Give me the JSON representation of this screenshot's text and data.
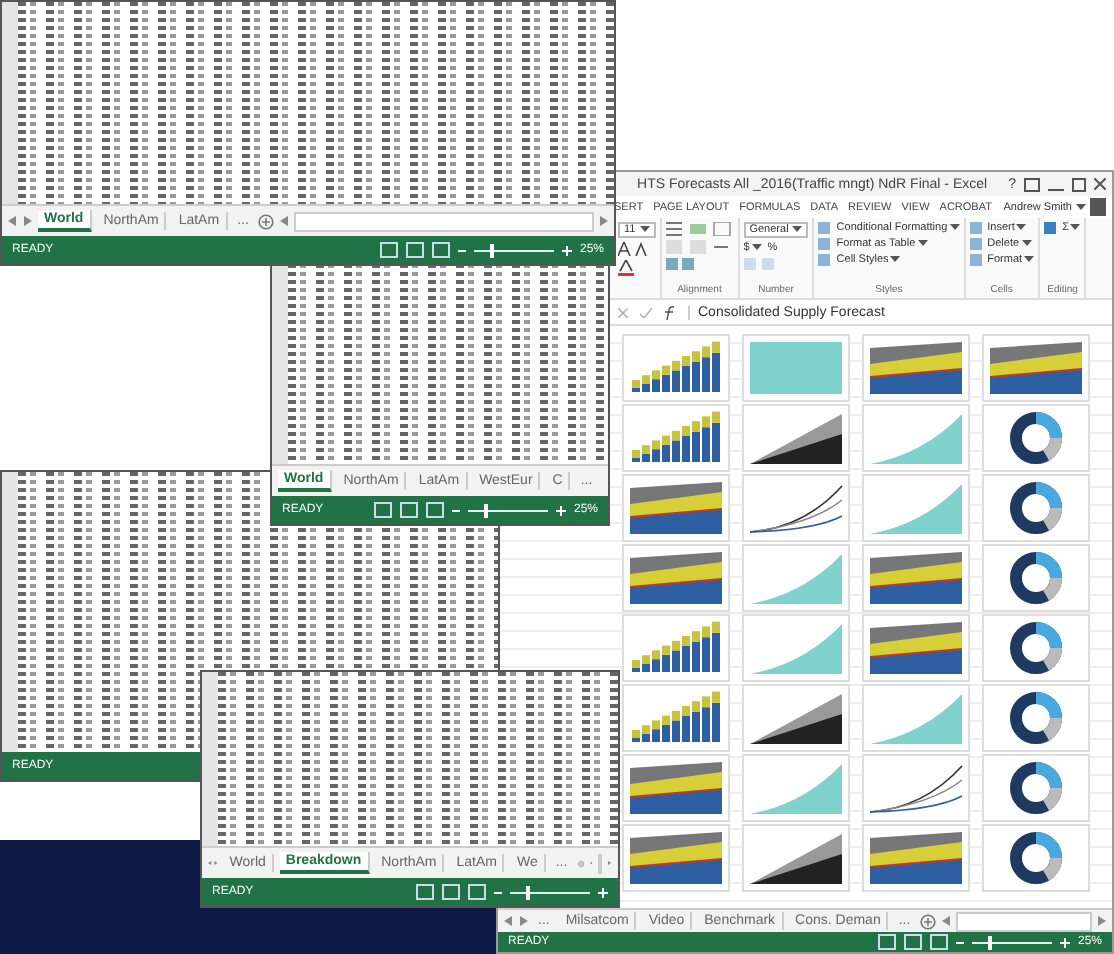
{
  "windows": [
    {
      "scroll_arrows": true,
      "tabs": [
        {
          "label": "World",
          "selected": true
        },
        {
          "label": "NorthAm",
          "selected": false
        },
        {
          "label": "LatAm",
          "selected": false
        }
      ],
      "overflow": "...",
      "status": "READY",
      "zoom": "25%",
      "level": 0.2
    },
    {
      "scroll_arrows": false,
      "tabs": [
        {
          "label": "World",
          "selected": true
        },
        {
          "label": "NorthAm",
          "selected": false
        },
        {
          "label": "LatAm",
          "selected": false
        },
        {
          "label": "WestEur",
          "selected": false
        },
        {
          "label": "C",
          "selected": false
        }
      ],
      "overflow": "...",
      "status": "READY",
      "zoom": "25%",
      "level": 0.2
    },
    {
      "status": "READY"
    },
    {
      "scroll_arrows": true,
      "tabs": [
        {
          "label": "World",
          "selected": false
        },
        {
          "label": "Breakdown",
          "selected": true
        },
        {
          "label": "NorthAm",
          "selected": false
        },
        {
          "label": "LatAm",
          "selected": false
        },
        {
          "label": "We",
          "selected": false
        }
      ],
      "overflow": "...",
      "status": "READY",
      "level": 0.2
    }
  ],
  "main_window": {
    "title": "HTS Forecasts All _2016(Traffic mngt) NdR Final - Excel",
    "help": "?",
    "ribbon_tabs": [
      {
        "label": "SERT",
        "selected": false
      },
      {
        "label": "PAGE LAYOUT",
        "selected": false
      },
      {
        "label": "FORMULAS",
        "selected": false
      },
      {
        "label": "DATA",
        "selected": false
      },
      {
        "label": "REVIEW",
        "selected": false
      },
      {
        "label": "VIEW",
        "selected": false
      },
      {
        "label": "ACROBAT",
        "selected": false
      }
    ],
    "user": "Andrew Smith",
    "ribbon_groups": [
      {
        "kind": "font",
        "size": "11"
      },
      {
        "kind": "alignment",
        "label": "Alignment"
      },
      {
        "kind": "number",
        "format": "General",
        "buttons": [
          "$",
          "%"
        ],
        "label": "Number"
      },
      {
        "kind": "styles",
        "buttons": [
          "Conditional Formatting",
          "Format as Table",
          "Cell Styles"
        ],
        "label": "Styles"
      },
      {
        "kind": "cells",
        "buttons": [
          "Insert",
          "Delete",
          "Format"
        ],
        "label": "Cells"
      },
      {
        "kind": "editing",
        "buttons": [
          "Σ"
        ],
        "label": "Editing"
      }
    ],
    "formula": "Consolidated Supply Forecast",
    "charts": [
      {
        "kind": "bars"
      },
      {
        "kind": "block"
      },
      {
        "kind": "stacked"
      },
      {
        "kind": "stacked"
      },
      {
        "kind": "bars"
      },
      {
        "kind": "dark"
      },
      {
        "kind": "area"
      },
      {
        "kind": "donut"
      },
      {
        "kind": "stacked"
      },
      {
        "kind": "line"
      },
      {
        "kind": "area"
      },
      {
        "kind": "donut"
      },
      {
        "kind": "stacked"
      },
      {
        "kind": "area"
      },
      {
        "kind": "stacked"
      },
      {
        "kind": "donut"
      },
      {
        "kind": "bars"
      },
      {
        "kind": "area"
      },
      {
        "kind": "stacked"
      },
      {
        "kind": "donut"
      },
      {
        "kind": "bars"
      },
      {
        "kind": "dark"
      },
      {
        "kind": "area"
      },
      {
        "kind": "donut"
      },
      {
        "kind": "stacked"
      },
      {
        "kind": "area"
      },
      {
        "kind": "line"
      },
      {
        "kind": "donut"
      },
      {
        "kind": "stacked"
      },
      {
        "kind": "dark"
      },
      {
        "kind": "stacked"
      },
      {
        "kind": "donut"
      }
    ],
    "overflow_left": "...",
    "tabs": [
      {
        "label": "Milsatcom",
        "selected": false
      },
      {
        "label": "Video",
        "selected": false
      },
      {
        "label": "Benchmark",
        "selected": false
      },
      {
        "label": "Cons. Deman",
        "selected": false
      }
    ],
    "overflow": "...",
    "status": "READY",
    "zoom": "25%",
    "level": 0.2
  }
}
